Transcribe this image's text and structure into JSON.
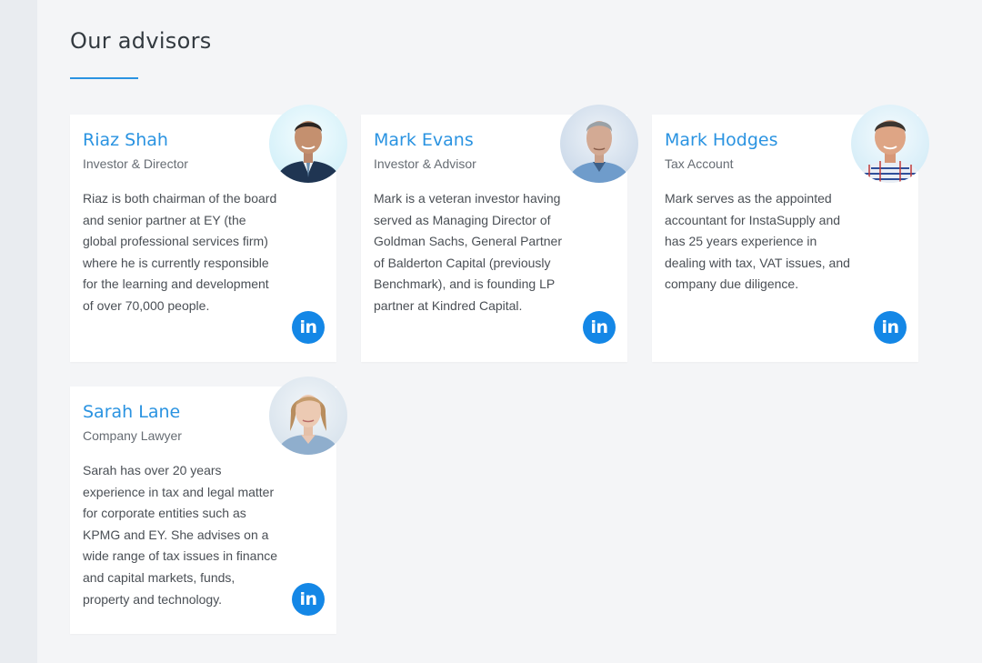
{
  "section": {
    "title": "Our advisors"
  },
  "advisors": [
    {
      "name": "Riaz Shah",
      "role": "Investor & Director",
      "bio": "Riaz is both chairman of the board and senior partner at EY (the global professional services firm) where he is currently responsible for the learning and development of over 70,000 people.",
      "linkedin_label": "in"
    },
    {
      "name": "Mark Evans",
      "role": "Investor & Advisor",
      "bio": "Mark is a veteran investor having served as Managing Director of Goldman Sachs, General Partner of Balderton Capital (previously Benchmark), and is founding LP partner at Kindred Capital.",
      "linkedin_label": "in"
    },
    {
      "name": "Mark Hodges",
      "role": "Tax Account",
      "bio": "Mark serves as the appointed accountant for InstaSupply and has 25 years experience in dealing with tax, VAT issues, and company due diligence.",
      "linkedin_label": "in"
    },
    {
      "name": "Sarah Lane",
      "role": "Company Lawyer",
      "bio": "Sarah has over 20 years experience in tax and legal matter for corporate entities such as KPMG and EY. She advises on a wide range of tax issues in finance and capital markets, funds, property and technology.",
      "linkedin_label": "in"
    }
  ],
  "colors": {
    "accent": "#2a93e1",
    "linkedin": "#1487e6",
    "background": "#f4f5f7",
    "card": "#ffffff"
  }
}
